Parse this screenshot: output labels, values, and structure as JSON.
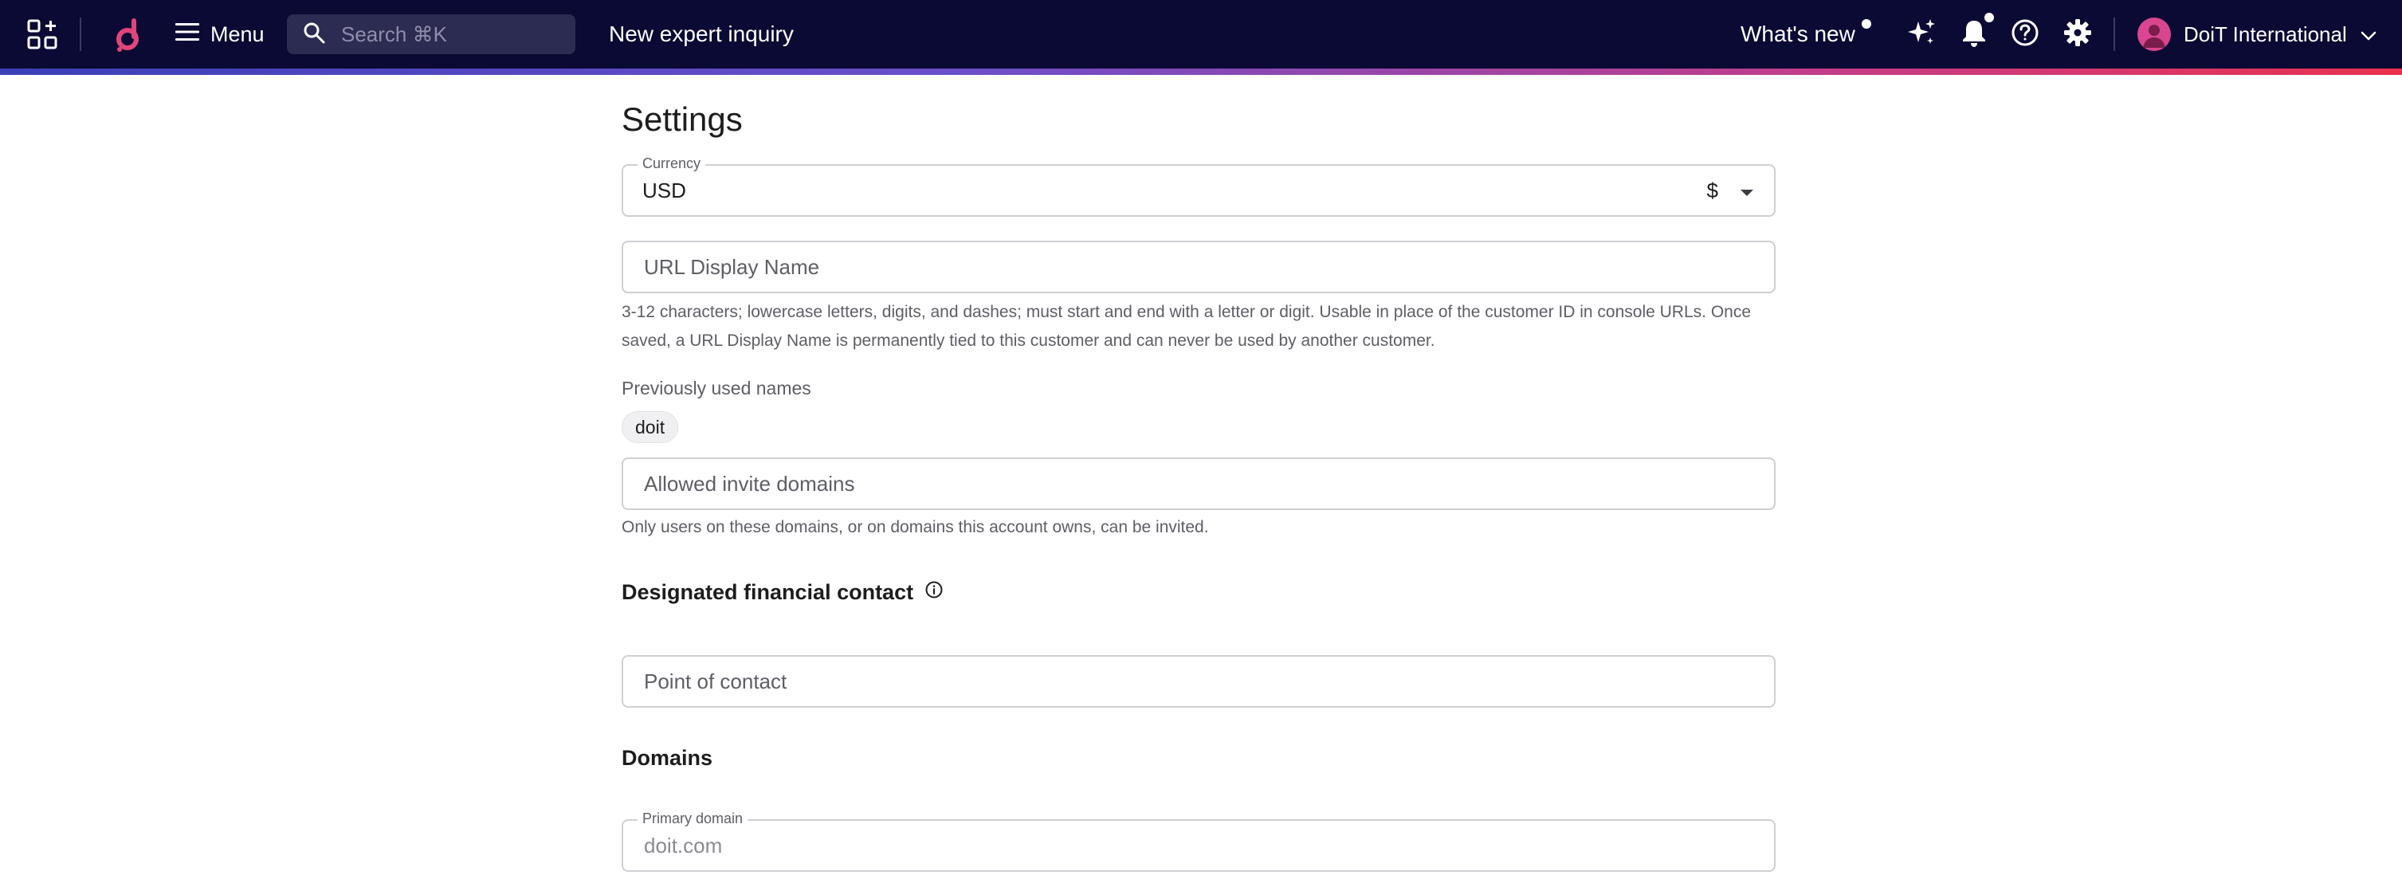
{
  "topbar": {
    "menu_label": "Menu",
    "search_placeholder": "Search ⌘K",
    "page_title": "New expert inquiry",
    "whats_new_label": "What's new",
    "account_name": "DoiT International",
    "colors": {
      "background": "#0b0a34",
      "accent_gradient": [
        "#3b3fb8",
        "#6b4fc9",
        "#c13d8a",
        "#e9324f"
      ],
      "logo": "#e0457b",
      "avatar": "#d9468f"
    },
    "icons": [
      "apps-grid-icon",
      "doit-logo-icon",
      "hamburger-menu-icon",
      "search-icon",
      "sparkle-ai-icon",
      "bell-icon",
      "help-circle-icon",
      "gear-icon",
      "chevron-down-icon"
    ]
  },
  "settings": {
    "heading": "Settings",
    "currency": {
      "label": "Currency",
      "value": "USD",
      "symbol": "$"
    },
    "url_display_name": {
      "placeholder": "URL Display Name",
      "helper": "3-12 characters; lowercase letters, digits, and dashes; must start and end with a letter or digit. Usable in place of the customer ID in console URLs. Once saved, a URL Display Name is permanently tied to this customer and can never be used by another customer.",
      "previously_used_label": "Previously used names",
      "previous_names": [
        "doit"
      ]
    },
    "allowed_invite_domains": {
      "placeholder": "Allowed invite domains",
      "helper": "Only users on these domains, or on domains this account owns, can be invited."
    },
    "financial_contact": {
      "heading": "Designated financial contact",
      "placeholder": "Point of contact"
    },
    "domains": {
      "heading": "Domains",
      "primary_label": "Primary domain",
      "primary_value": "doit.com"
    }
  }
}
